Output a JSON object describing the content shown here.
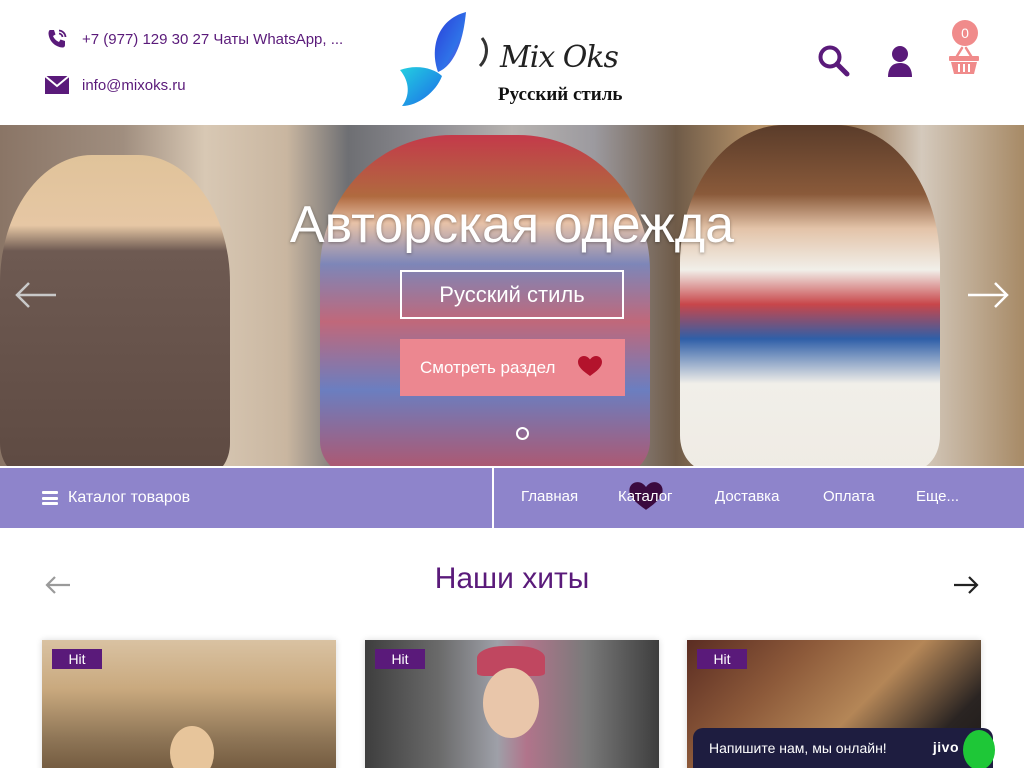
{
  "header": {
    "phone": "+7 (977) 129 30 27 Чаты WhatsApp, ...",
    "email": "info@mixoks.ru",
    "logo": {
      "wordmark": "Mix Oks",
      "tagline": "Русский стиль"
    },
    "cart_count": "0",
    "icons": [
      "phone-icon",
      "mail-icon",
      "search-icon",
      "user-icon",
      "basket-icon"
    ]
  },
  "hero": {
    "title": "Авторская одежда",
    "subtitle": "Русский стиль",
    "button_label": "Смотреть раздел",
    "slides_count": 1
  },
  "nav": {
    "catalog_label": "Каталог товаров",
    "links": [
      "Главная",
      "Каталог",
      "Доставка",
      "Оплата",
      "Еще..."
    ]
  },
  "hits": {
    "title": "Наши хиты",
    "cards": [
      {
        "badge": "Hit"
      },
      {
        "badge": "Hit"
      },
      {
        "badge": "Hit"
      }
    ]
  },
  "chat": {
    "label": "Напишите нам, мы онлайн!",
    "brand": "jivo"
  },
  "colors": {
    "brand_purple": "#5a1a7a",
    "nav_bg": "#8e84cb",
    "hero_button": "#ec8790",
    "cart_badge": "#f08b8b",
    "heart": "#b3132c",
    "chat_bg": "#1e1d40",
    "chat_green": "#1ec737"
  }
}
